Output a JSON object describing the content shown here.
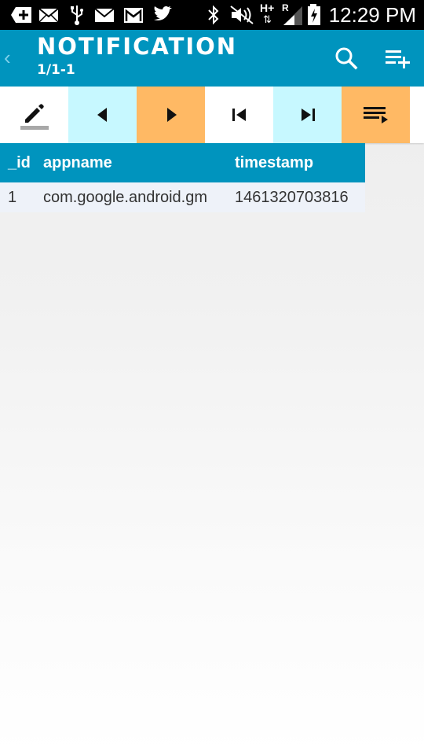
{
  "status_bar": {
    "time": "12:29 PM",
    "icons": [
      "add-icon",
      "mail-icon",
      "usb-icon",
      "mail-icon",
      "gmail-icon",
      "twitter-icon",
      "bluetooth-icon",
      "mute-icon",
      "data-hplus-icon",
      "signal-icon",
      "battery-charging-icon"
    ],
    "network_label": "H+",
    "roaming_label": "R"
  },
  "action_bar": {
    "title": "NOTIFICATION",
    "subtitle": "1/1-1",
    "back_icon": "chevron-left-icon",
    "actions": [
      "search-icon",
      "playlist-add-icon"
    ]
  },
  "toolbar": {
    "buttons": [
      {
        "name": "edit-button",
        "icon": "pencil-icon"
      },
      {
        "name": "previous-button",
        "icon": "triangle-left-icon"
      },
      {
        "name": "next-button",
        "icon": "triangle-right-icon"
      },
      {
        "name": "first-button",
        "icon": "skip-first-icon"
      },
      {
        "name": "last-button",
        "icon": "skip-last-icon"
      },
      {
        "name": "list-button",
        "icon": "playlist-play-icon"
      }
    ]
  },
  "table": {
    "columns": [
      "_id",
      "appname",
      "timestamp"
    ],
    "rows": [
      [
        "1",
        "com.google.android.gm",
        "1461320703816"
      ]
    ]
  },
  "colors": {
    "primary": "#0094be",
    "cyan_button": "#c7f8ff",
    "orange_button": "#ffb964",
    "row_background": "#eef2f9"
  }
}
